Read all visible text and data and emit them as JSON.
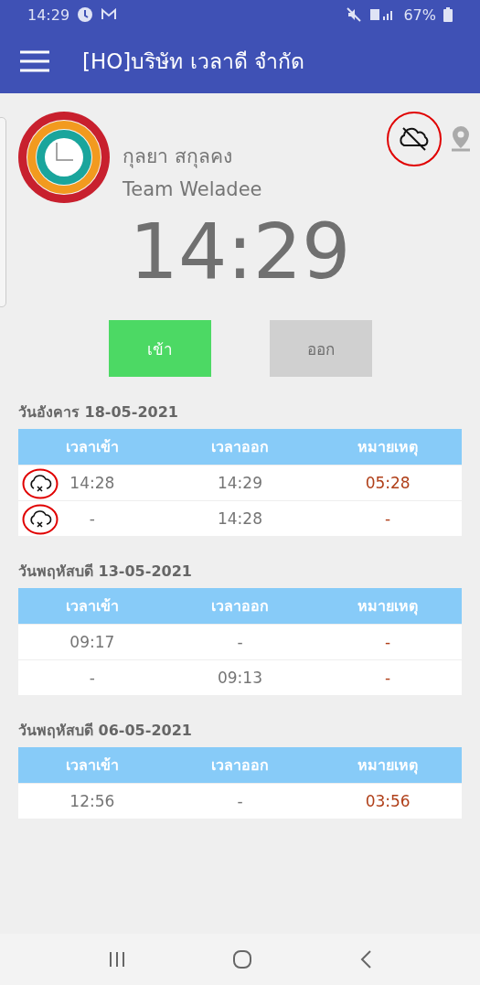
{
  "status_bar": {
    "time": "14:29",
    "battery": "67%"
  },
  "app_bar": {
    "title": "[HO]บริษัท เวลาดี จำกัด"
  },
  "profile": {
    "name": "กุลยา สกุลคง",
    "team": "Team Weladee",
    "offline": true
  },
  "clock": "14:29",
  "buttons": [
    {
      "label": "เข้า",
      "disabled": false
    },
    {
      "label": "ออก",
      "disabled": true
    }
  ],
  "days": [
    {
      "date": "วันอังคาร 18-05-2021",
      "columns": [
        "เวลาเข้า",
        "เวลาออก",
        "หมายเหตุ"
      ],
      "rows": [
        {
          "unsynced": true,
          "in": "14:28",
          "out": "14:29",
          "note": "05:28"
        },
        {
          "unsynced": true,
          "in": "-",
          "out": "14:28",
          "note": "-"
        }
      ]
    },
    {
      "date": "วันพฤหัสบดี 13-05-2021",
      "columns": [
        "เวลาเข้า",
        "เวลาออก",
        "หมายเหตุ"
      ],
      "rows": [
        {
          "unsynced": false,
          "in": "09:17",
          "out": "-",
          "note": "-"
        },
        {
          "unsynced": false,
          "in": "-",
          "out": "09:13",
          "note": "-"
        }
      ]
    },
    {
      "date": "วันพฤหัสบดี 06-05-2021",
      "columns": [
        "เวลาเข้า",
        "เวลาออก",
        "หมายเหตุ"
      ],
      "rows": [
        {
          "unsynced": false,
          "in": "12:56",
          "out": "-",
          "note": "03:56"
        }
      ]
    }
  ]
}
